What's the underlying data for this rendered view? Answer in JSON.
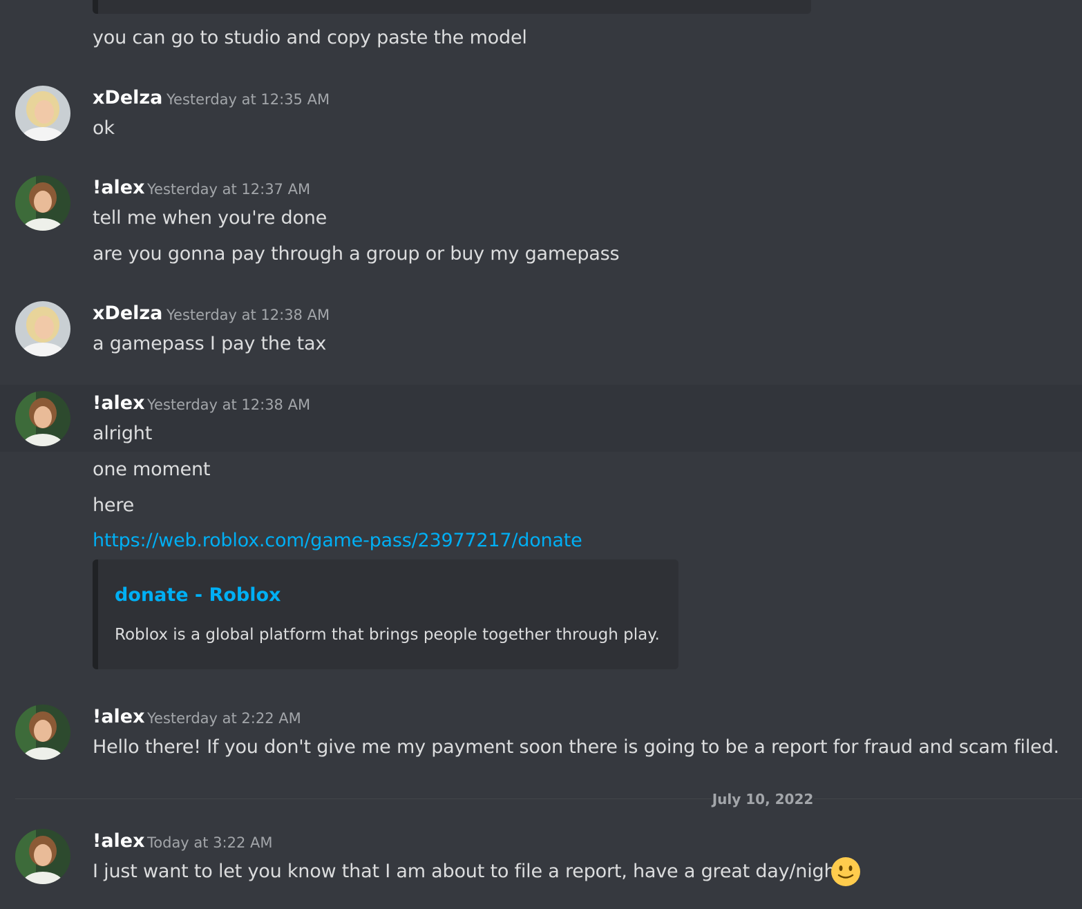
{
  "messages": {
    "m0": {
      "lines": [
        "you can go to studio and copy paste the model"
      ]
    },
    "m1": {
      "author": "xDelza",
      "timestamp": "Yesterday at 12:35 AM",
      "lines": [
        "ok"
      ]
    },
    "m2": {
      "author": "!alex",
      "timestamp": "Yesterday at 12:37 AM",
      "lines": [
        "tell me when you're done",
        "are you gonna pay through a group or buy my gamepass"
      ]
    },
    "m3": {
      "author": "xDelza",
      "timestamp": "Yesterday at 12:38 AM",
      "lines": [
        "a gamepass I pay the tax"
      ]
    },
    "m4": {
      "author": "!alex",
      "timestamp": "Yesterday at 12:38 AM",
      "lines": [
        "alright",
        "one moment",
        "here"
      ],
      "link": "https://web.roblox.com/game-pass/23977217/donate",
      "embed": {
        "title": "donate - Roblox",
        "description": "Roblox is a global platform that brings people together through play."
      }
    },
    "m5": {
      "author": "!alex",
      "timestamp": "Yesterday at 2:22 AM",
      "lines": [
        "Hello there! If you don't give me my payment soon there is going to be a report for fraud and scam filed."
      ]
    },
    "m6": {
      "author": "!alex",
      "timestamp": "Today at 3:22 AM",
      "lines": [
        "I just want to let you know that I am about to file a report, have a great day/night!"
      ],
      "emoji": "slightly-smiling-face"
    }
  },
  "date_divider": "July 10, 2022",
  "colors": {
    "background": "#36393f",
    "hover_row": "#32353b",
    "embed_bg": "#2f3136",
    "link": "#00aff4",
    "text": "#dcddde",
    "timestamp": "#a3a6aa"
  }
}
